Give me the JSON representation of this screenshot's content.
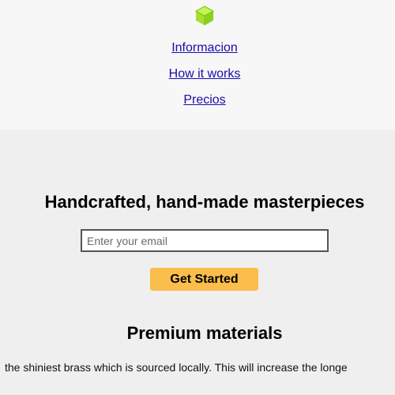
{
  "brand": {
    "logo_icon": "cube-icon",
    "logo_color": "#a6df2f"
  },
  "nav": {
    "items": [
      {
        "label": "Informacion"
      },
      {
        "label": "How it works"
      },
      {
        "label": "Precios"
      }
    ],
    "link_color": "#1a0dab"
  },
  "hero": {
    "title": "Handcrafted, hand-made masterpieces",
    "email_placeholder": "Enter your email",
    "cta_label": "Get Started",
    "cta_color": "#fbbd4c"
  },
  "features": [
    {
      "title": "Premium materials",
      "text": "the shiniest brass which is sourced locally. This will increase the longe"
    }
  ],
  "colors": {
    "header_bg": "#f7f7f7",
    "page_bg": "#efefef",
    "input_border": "#555555"
  }
}
